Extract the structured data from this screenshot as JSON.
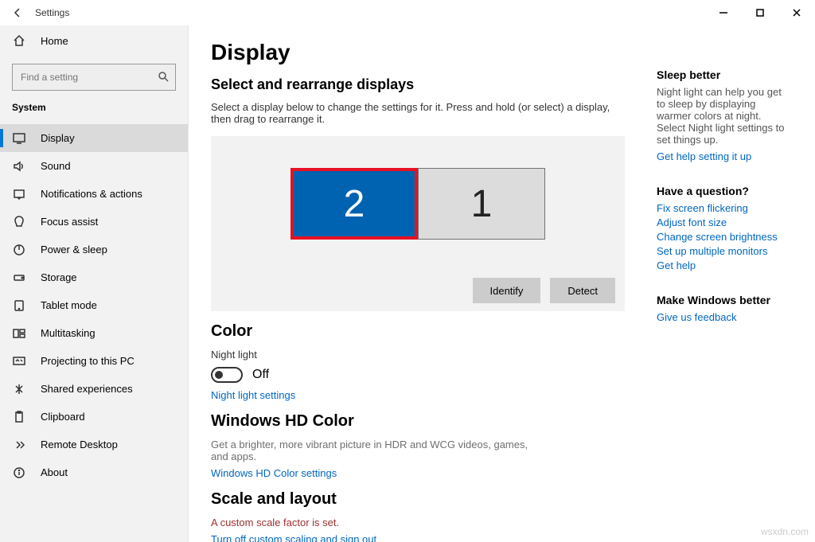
{
  "titlebar": {
    "title": "Settings"
  },
  "sidebar": {
    "home": "Home",
    "search_placeholder": "Find a setting",
    "category": "System",
    "items": [
      {
        "label": "Display"
      },
      {
        "label": "Sound"
      },
      {
        "label": "Notifications & actions"
      },
      {
        "label": "Focus assist"
      },
      {
        "label": "Power & sleep"
      },
      {
        "label": "Storage"
      },
      {
        "label": "Tablet mode"
      },
      {
        "label": "Multitasking"
      },
      {
        "label": "Projecting to this PC"
      },
      {
        "label": "Shared experiences"
      },
      {
        "label": "Clipboard"
      },
      {
        "label": "Remote Desktop"
      },
      {
        "label": "About"
      }
    ]
  },
  "main": {
    "heading": "Display",
    "section1": {
      "title": "Select and rearrange displays",
      "desc": "Select a display below to change the settings for it. Press and hold (or select) a display, then drag to rearrange it.",
      "disp2": "2",
      "disp1": "1",
      "identify": "Identify",
      "detect": "Detect"
    },
    "color": {
      "title": "Color",
      "nl_label": "Night light",
      "nl_state": "Off",
      "nl_link": "Night light settings"
    },
    "hd": {
      "title": "Windows HD Color",
      "desc": "Get a brighter, more vibrant picture in HDR and WCG videos, games, and apps.",
      "link": "Windows HD Color settings"
    },
    "scale": {
      "title": "Scale and layout",
      "warn": "A custom scale factor is set.",
      "link": "Turn off custom scaling and sign out"
    }
  },
  "right": {
    "sleep": {
      "title": "Sleep better",
      "desc": "Night light can help you get to sleep by displaying warmer colors at night. Select Night light settings to set things up.",
      "link": "Get help setting it up"
    },
    "question": {
      "title": "Have a question?",
      "links": [
        "Fix screen flickering",
        "Adjust font size",
        "Change screen brightness",
        "Set up multiple monitors",
        "Get help"
      ]
    },
    "better": {
      "title": "Make Windows better",
      "link": "Give us feedback"
    }
  },
  "watermark": "wsxdn.com"
}
